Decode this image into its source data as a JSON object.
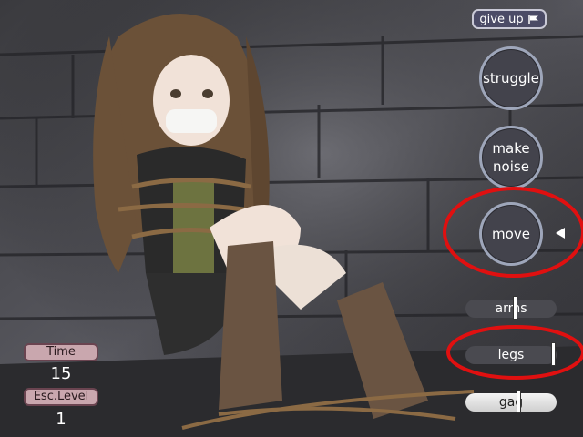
{
  "controls": {
    "give_up_label": "give up",
    "struggle_label": "struggle",
    "make_noise_label": "make\nnoise",
    "move_label": "move"
  },
  "meters": {
    "arms": {
      "label": "arms",
      "level": 0.55
    },
    "legs": {
      "label": "legs",
      "level": 1.0
    },
    "gag": {
      "label": "gag",
      "level": 0.6
    }
  },
  "status": {
    "time_label": "Time",
    "time_value": "15",
    "esc_label": "Esc.Level",
    "esc_value": "1"
  },
  "colors": {
    "button_fill": "#43434c",
    "button_border": "#9ea6ba",
    "highlight_ring": "#e01010",
    "label_box": "#c9a7ae"
  },
  "icons": {
    "give_up": "flag-icon",
    "selector": "triangle-left-icon"
  }
}
